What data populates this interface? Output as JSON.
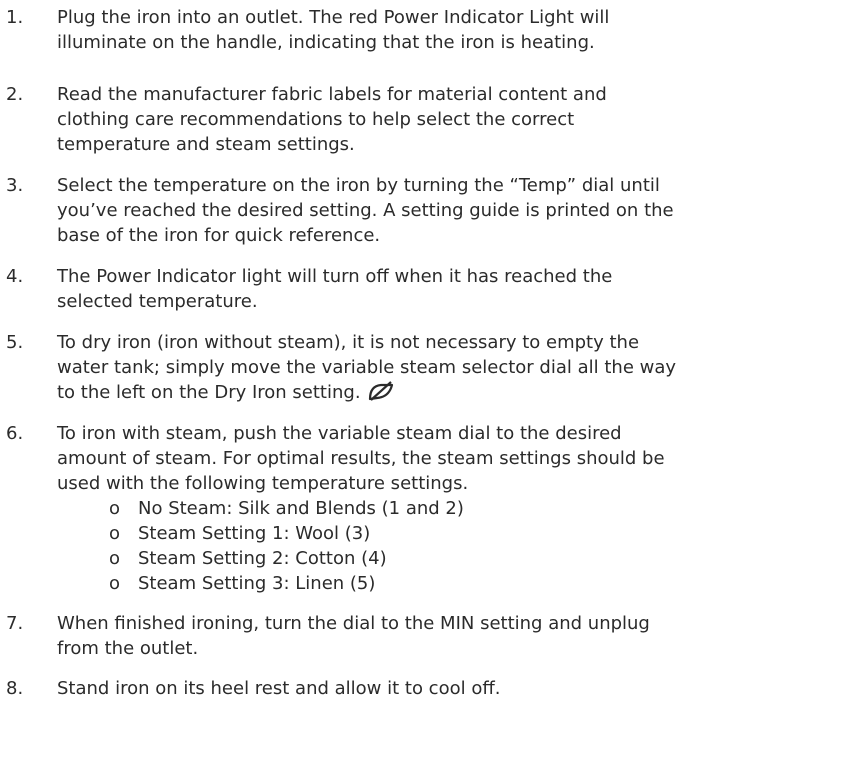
{
  "steps": [
    {
      "num": "1.",
      "lines": [
        "Plug the iron into an outlet. The red Power Indicator Light will",
        "illuminate on the handle, indicating that the iron is heating."
      ]
    },
    {
      "num": "2.",
      "lines": [
        "Read the manufacturer fabric labels for material content and",
        "clothing care recommendations to help select the correct",
        "temperature and steam settings."
      ]
    },
    {
      "num": "3.",
      "lines": [
        "Select the temperature on the iron by turning the “Temp” dial until",
        "you’ve reached the desired setting. A setting guide is printed on the",
        "base of the iron for quick reference."
      ]
    },
    {
      "num": "4.",
      "lines": [
        "The Power Indicator light will turn off when it has reached the",
        "selected temperature."
      ]
    },
    {
      "num": "5.",
      "lines": [
        "To dry iron (iron without steam), it is not necessary to empty the",
        "water tank; simply move the variable steam selector dial all the way",
        "to the left on the Dry Iron setting."
      ],
      "icon": "dry-iron-no-steam-icon"
    },
    {
      "num": "6.",
      "lines": [
        "To iron with steam, push the variable steam dial to the desired",
        "amount of steam. For optimal results, the steam settings should be",
        "used with the following temperature settings."
      ],
      "bullet": "o",
      "subitems": [
        "No Steam: Silk and Blends (1 and 2)",
        "Steam Setting 1: Wool (3)",
        "Steam Setting 2: Cotton (4)",
        "Steam Setting 3: Linen (5)"
      ]
    },
    {
      "num": "7.",
      "lines": [
        "When finished ironing, turn the dial to the MIN setting and unplug",
        "from the outlet."
      ]
    },
    {
      "num": "8.",
      "lines": [
        "Stand iron on its heel rest and allow it to cool off."
      ]
    }
  ]
}
